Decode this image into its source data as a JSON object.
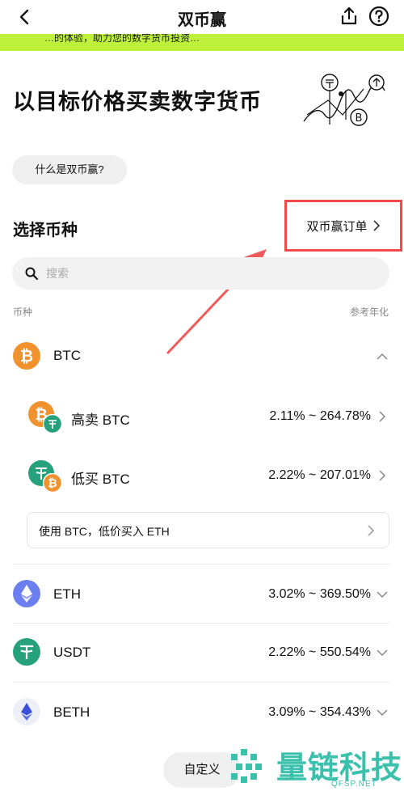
{
  "nav": {
    "title": "双币赢"
  },
  "banner": {
    "text": "…的体验，助力您的数字货币投资…"
  },
  "hero": {
    "title": "以目标价格买卖数字货币"
  },
  "what_is": {
    "label": "什么是双币赢?"
  },
  "section": {
    "title": "选择币种",
    "orders_label": "双币赢订单"
  },
  "search": {
    "placeholder": "搜索",
    "value": ""
  },
  "columns": {
    "left": "币种",
    "right": "参考年化"
  },
  "coins": {
    "btc": {
      "name": "BTC",
      "expanded": true
    },
    "sell_high": {
      "name": "高卖 BTC",
      "rate": "2.11% ~ 264.78%"
    },
    "buy_low": {
      "name": "低买 BTC",
      "rate": "2.22% ~ 207.01%"
    },
    "swap": {
      "label": "使用 BTC，低价买入 ETH"
    },
    "eth": {
      "name": "ETH",
      "rate": "3.02% ~ 369.50%"
    },
    "usdt": {
      "name": "USDT",
      "rate": "2.22% ~ 550.54%"
    },
    "beth": {
      "name": "BETH",
      "rate": "3.09% ~ 354.43%"
    }
  },
  "custom": {
    "label": "自定义"
  },
  "watermark": {
    "text": "量链科技",
    "sub": "QFSP.NET"
  },
  "colors": {
    "banner": "#bef23a",
    "btc": "#f2922e",
    "usdt": "#26a17b",
    "eth": "#6b7ff0",
    "highlight": "#f04a4a"
  }
}
